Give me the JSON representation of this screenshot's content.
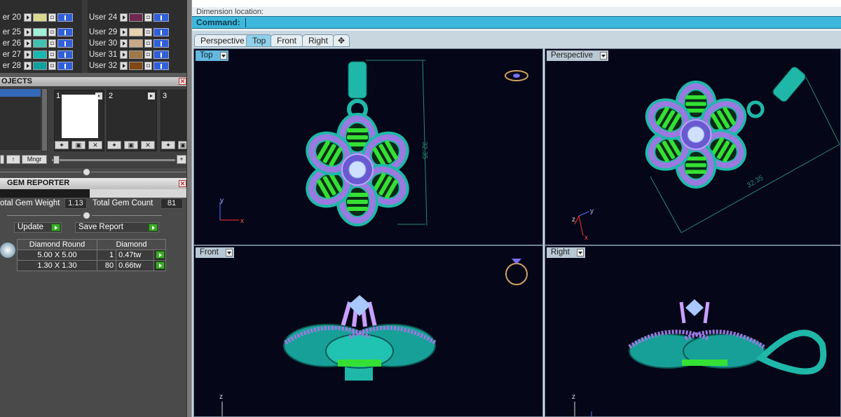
{
  "layers": {
    "left_column": [
      {
        "label": "er 20",
        "color": "#d8d890"
      },
      {
        "label": "er 25",
        "color": "#a0f0d8"
      },
      {
        "label": "er 26",
        "color": "#40c0b0"
      },
      {
        "label": "er 27",
        "color": "#18b8b0"
      },
      {
        "label": "er 28",
        "color": "#10a0a0"
      }
    ],
    "right_column": [
      {
        "label": "User 24",
        "color": "#702850"
      },
      {
        "label": "User 29",
        "color": "#e8d0b0"
      },
      {
        "label": "User 30",
        "color": "#c8a888"
      },
      {
        "label": "User 31",
        "color": "#a07848"
      },
      {
        "label": "User 32",
        "color": "#804818"
      }
    ]
  },
  "objects_panel": {
    "title": "OJECTS",
    "slots": [
      {
        "num": "1"
      },
      {
        "num": "2"
      },
      {
        "num": "3"
      }
    ],
    "manager_label": "Mngr"
  },
  "gem_reporter": {
    "title": "GEM REPORTER",
    "total_weight_label": "otal Gem Weight",
    "total_weight_value": "1.13",
    "total_count_label": "Total Gem Count",
    "total_count_value": "81",
    "update_label": "Update",
    "save_label": "Save Report",
    "table_header": {
      "shape": "Diamond Round",
      "type": "Diamond"
    },
    "rows": [
      {
        "size": "5.00 X 5.00",
        "count": "1",
        "weight": "0.47tw"
      },
      {
        "size": "1.30 X 1.30",
        "count": "80",
        "weight": "0.66tw"
      }
    ]
  },
  "command": {
    "history_text": "Dimension location:",
    "prompt_label": "Command:"
  },
  "tabs": [
    {
      "label": "Perspective",
      "active": false
    },
    {
      "label": "Top",
      "active": true
    },
    {
      "label": "Front",
      "active": false
    },
    {
      "label": "Right",
      "active": false
    }
  ],
  "viewports": {
    "top": {
      "title": "Top",
      "dimension": "32.35",
      "axis_a": "y",
      "axis_b": "x"
    },
    "perspective": {
      "title": "Perspective",
      "dimension": "32.35",
      "axis_a": "y",
      "axis_b": "x",
      "axis_c": "z"
    },
    "front": {
      "title": "Front",
      "axis_a": "z"
    },
    "right": {
      "title": "Right",
      "axis_a": "z"
    }
  },
  "colors": {
    "metal": "#1fb8a8",
    "gem": "#9a7ae0",
    "green": "#35e035",
    "viewport_bg": "#050618",
    "command_bar": "#3db8dc"
  }
}
